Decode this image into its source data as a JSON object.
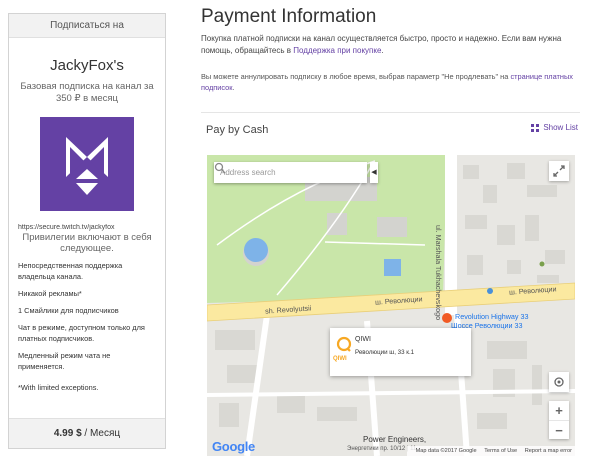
{
  "card": {
    "header": "Подписаться на",
    "channel": "JackyFox's",
    "subtitle": "Базовая подписка на канал за 350 ₽ в месяц",
    "logo_icon": "twitch-emote-icon",
    "url": "https://secure.twitch.tv/jackyfox",
    "privileges": "Привилегии включают в себя следующее.",
    "features": [
      "Непосредственная поддержка владельца канала.",
      "Никакой рекламы*",
      "1 Смайлики для подписчиков",
      "Чат в режиме, доступном только для платных подписчиков.",
      "Медленный режим чата не применяется.",
      "*With limited exceptions."
    ],
    "price": "4.99 $",
    "period": " / Месяц"
  },
  "main": {
    "title": "Payment Information",
    "intro": "Покупка платной подписки на канал осуществляется быстро, просто и надежно. Если вам нужна помощь, обращайтесь в ",
    "intro_link": "Поддержка при покупке",
    "intro_end": ".",
    "cancel_text": "Вы можете аннулировать подписку в любое время, выбрав параметр \"Не продлевать\" на ",
    "cancel_link": "странице платных подписок",
    "cancel_end": "."
  },
  "pay": {
    "title": "Pay by Cash",
    "show_list": "Show List"
  },
  "map": {
    "search_placeholder": "Address search",
    "labels": {
      "street_marshala": "ul. Marshala Tukhachevskogo",
      "sh_revolyutsii_1": "ш. Революции",
      "sh_revolyutsii_2": "ш. Революции",
      "sh_revolyutsii_3": "sh. Revolyutsii",
      "revolution_highway": "Revolution Highway 33",
      "shosse_revolyutsii": "Шоссе Революции 33",
      "power_engineers": "Power Engineers,",
      "power_addr": "Энергетики пр. 10/12 | 11"
    },
    "info": {
      "name": "QIWI",
      "address": "Революции ш, 33 к.1",
      "logo": "QIWI"
    },
    "zoom_in": "+",
    "zoom_out": "−",
    "google": "Google",
    "attribution": {
      "data": "Map data ©2017 Google",
      "terms": "Terms of Use",
      "report": "Report a map error"
    }
  },
  "colors": {
    "brand": "#6441a4",
    "park": "#c5e6a6",
    "road": "#ffffff",
    "highway": "#fbe9a0"
  }
}
